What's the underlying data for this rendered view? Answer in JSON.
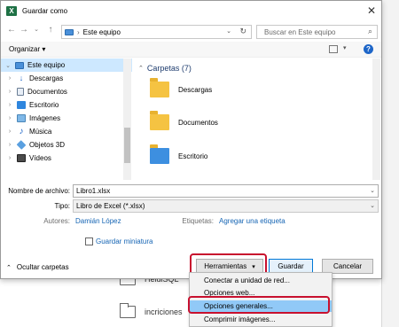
{
  "window": {
    "title": "Guardar como",
    "app_icon_letter": "X"
  },
  "nav": {
    "address": "Este equipo",
    "search_placeholder": "Buscar en Este equipo"
  },
  "toolbar": {
    "organize": "Organizar ▾"
  },
  "tree": [
    {
      "label": "Este equipo",
      "icon": "computer-icon",
      "selected": true
    },
    {
      "label": "Descargas",
      "icon": "download-icon"
    },
    {
      "label": "Documentos",
      "icon": "document-icon"
    },
    {
      "label": "Escritorio",
      "icon": "desktop-icon"
    },
    {
      "label": "Imágenes",
      "icon": "image-icon"
    },
    {
      "label": "Música",
      "icon": "music-icon"
    },
    {
      "label": "Objetos 3D",
      "icon": "cube-icon"
    },
    {
      "label": "Vídeos",
      "icon": "video-icon"
    }
  ],
  "content": {
    "group_header": "Carpetas (7)",
    "items": [
      "Descargas",
      "Documentos",
      "Escritorio"
    ]
  },
  "form": {
    "filename_label": "Nombre de archivo:",
    "filename_value": "Libro1.xlsx",
    "type_label": "Tipo:",
    "type_value": "Libro de Excel (*.xlsx)",
    "authors_label": "Autores:",
    "authors_value": "Damián López",
    "tags_label": "Etiquetas:",
    "tags_value": "Agregar una etiqueta",
    "thumbnail_label": "Guardar miniatura"
  },
  "footer": {
    "hide_folders": "Ocultar carpetas",
    "tools": "Herramientas",
    "save": "Guardar",
    "cancel": "Cancelar"
  },
  "menu": {
    "items": [
      "Conectar a unidad de red...",
      "Opciones web...",
      "Opciones generales...",
      "Comprimir imágenes..."
    ],
    "highlighted_index": 2
  },
  "background": {
    "items": [
      "HeidiSQL",
      "incriciones"
    ]
  },
  "colors": {
    "accent": "#0078d7",
    "highlight_border": "#c8102e",
    "folder": "#f5c342",
    "excel": "#1e7145"
  }
}
